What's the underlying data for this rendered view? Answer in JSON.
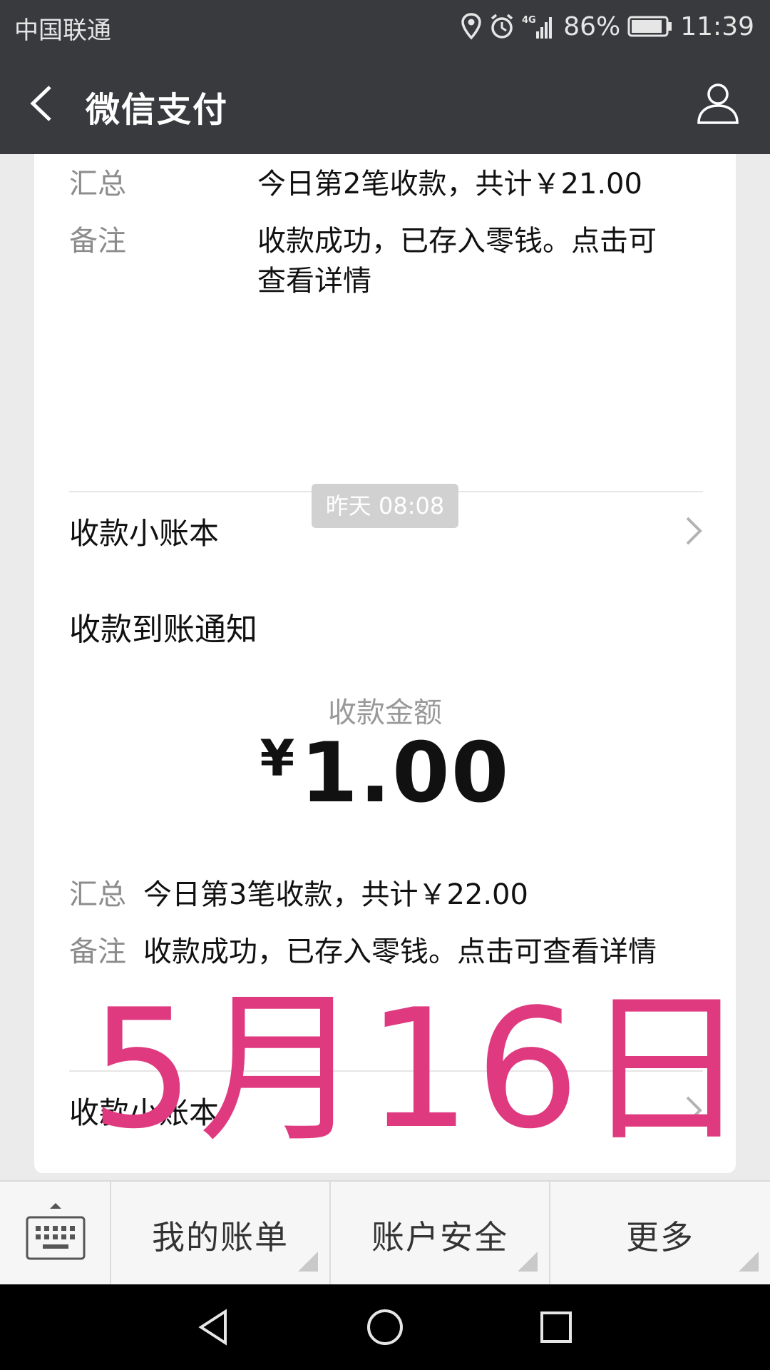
{
  "status_bar": {
    "carrier": "中国联通",
    "network": "4G",
    "battery": "86%",
    "time": "11:39",
    "icons": [
      "location-icon",
      "alarm-icon",
      "signal-icon",
      "battery-icon"
    ]
  },
  "nav": {
    "title": "微信支付",
    "back_icon": "back-arrow-icon",
    "profile_icon": "user-profile-icon"
  },
  "card1": {
    "summary_label": "汇总",
    "summary_value": "今日第2笔收款，共计￥21.00",
    "note_label": "备注",
    "note_value": "收款成功，已存入零钱。点击可查看详情",
    "ledger_label": "收款小账本"
  },
  "timestamp": "昨天 08:08",
  "card2": {
    "title": "收款到账通知",
    "amount_label": "收款金额",
    "currency_symbol": "¥",
    "amount": "1.00",
    "summary_label": "汇总",
    "summary_value": "今日第3笔收款，共计￥22.00",
    "note_label": "备注",
    "note_value": "收款成功，已存入零钱。点击可查看详情",
    "ledger_label": "收款小账本"
  },
  "overlay_text": "5月16日",
  "bottom_menu": {
    "keyboard_icon": "keyboard-icon",
    "items": [
      {
        "label": "我的账单"
      },
      {
        "label": "账户安全"
      },
      {
        "label": "更多"
      }
    ]
  },
  "system_nav": [
    "back-triangle-icon",
    "home-circle-icon",
    "recents-square-icon"
  ],
  "colors": {
    "bar_bg": "#393a3e",
    "page_bg": "#ebebeb",
    "overlay": "#df3a80"
  }
}
